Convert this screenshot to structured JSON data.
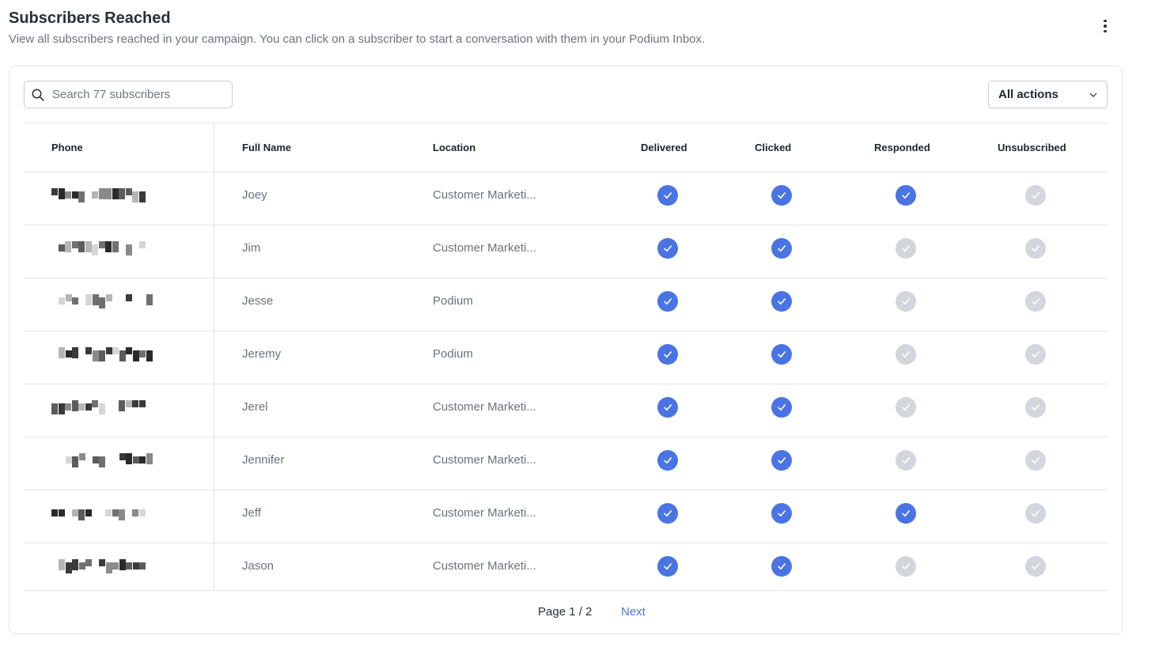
{
  "header": {
    "title": "Subscribers Reached",
    "subtitle": "View all subscribers reached in your campaign. You can click on a subscriber to start a conversation with them in your Podium Inbox."
  },
  "search": {
    "placeholder": "Search 77 subscribers",
    "icon": "search-icon"
  },
  "filter": {
    "selected": "All actions",
    "icon": "chevron-down-icon"
  },
  "colors": {
    "accent": "#4a74e4",
    "check_on": "#4a74e4",
    "check_off": "#d3d6dc"
  },
  "table": {
    "columns": [
      "Phone",
      "Full Name",
      "Location",
      "Delivered",
      "Clicked",
      "Responded",
      "Unsubscribed"
    ],
    "rows": [
      {
        "name": "Joey",
        "location": "Customer Marketi...",
        "delivered": true,
        "clicked": true,
        "responded": true,
        "unsubscribed": false
      },
      {
        "name": "Jim",
        "location": "Customer Marketi...",
        "delivered": true,
        "clicked": true,
        "responded": false,
        "unsubscribed": false
      },
      {
        "name": "Jesse",
        "location": "Podium",
        "delivered": true,
        "clicked": true,
        "responded": false,
        "unsubscribed": false
      },
      {
        "name": "Jeremy",
        "location": "Podium",
        "delivered": true,
        "clicked": true,
        "responded": false,
        "unsubscribed": false
      },
      {
        "name": "Jerel",
        "location": "Customer Marketi...",
        "delivered": true,
        "clicked": true,
        "responded": false,
        "unsubscribed": false
      },
      {
        "name": "Jennifer",
        "location": "Customer Marketi...",
        "delivered": true,
        "clicked": true,
        "responded": false,
        "unsubscribed": false
      },
      {
        "name": "Jeff",
        "location": "Customer Marketi...",
        "delivered": true,
        "clicked": true,
        "responded": true,
        "unsubscribed": false
      },
      {
        "name": "Jason",
        "location": "Customer Marketi...",
        "delivered": true,
        "clicked": true,
        "responded": false,
        "unsubscribed": false
      }
    ]
  },
  "pagination": {
    "page_label": "Page 1 / 2",
    "next_label": "Next"
  }
}
